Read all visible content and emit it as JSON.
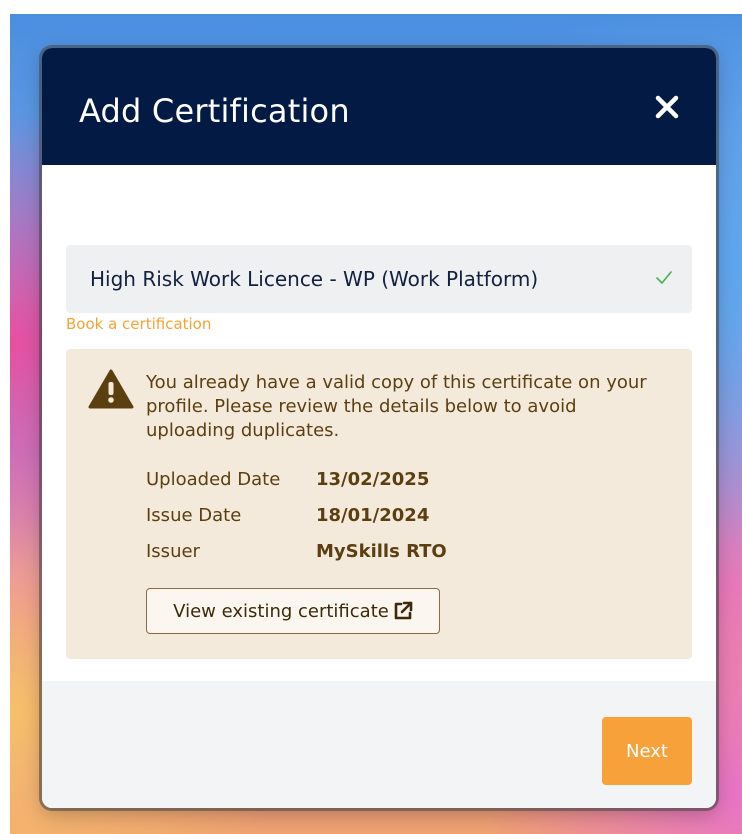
{
  "modal": {
    "title": "Add Certification"
  },
  "selection": {
    "value": "High Risk Work Licence - WP (Work Platform)"
  },
  "book_link": "Book a certification",
  "warning": {
    "message": "You already have a valid copy of this certificate on your profile. Please review the details below to avoid uploading duplicates.",
    "details": [
      {
        "label": "Uploaded Date",
        "value": "13/02/2025"
      },
      {
        "label": "Issue Date",
        "value": "18/01/2024"
      },
      {
        "label": "Issuer",
        "value": "MySkills RTO"
      }
    ],
    "view_button": "View existing certificate"
  },
  "footer": {
    "next_label": "Next"
  },
  "colors": {
    "header_bg": "#031a44",
    "accent_orange": "#f7a13a",
    "warning_bg": "#f4eadc",
    "warning_text": "#5c3f10",
    "check_green": "#4caf50"
  },
  "icons": {
    "close": "close-icon",
    "check": "check-icon",
    "warning": "warning-icon",
    "external": "external-link-icon"
  }
}
